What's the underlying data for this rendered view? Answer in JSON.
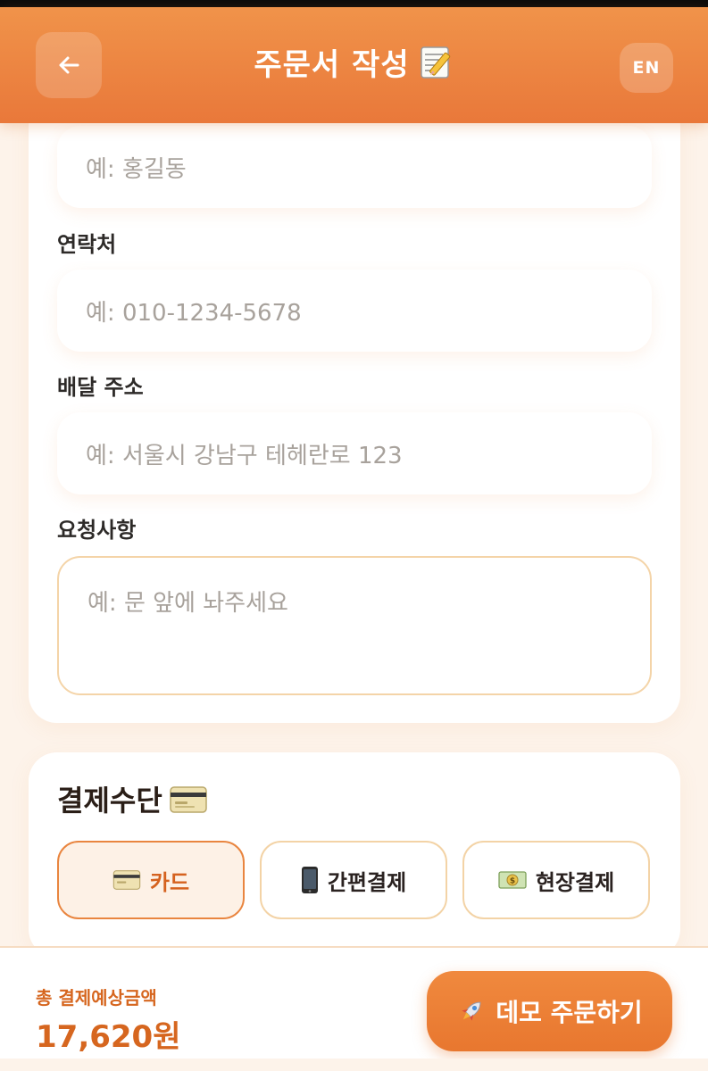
{
  "header": {
    "title": "주문서 작성",
    "title_icon": "memo-icon",
    "back_icon": "arrow-left-icon",
    "lang_label": "EN"
  },
  "form": {
    "name": {
      "placeholder": "예: 홍길동"
    },
    "phone": {
      "label": "연락처",
      "placeholder": "예: 010-1234-5678"
    },
    "address": {
      "label": "배달 주소",
      "placeholder": "예: 서울시 강남구 테헤란로 123"
    },
    "request": {
      "label": "요청사항",
      "placeholder": "예: 문 앞에 놔주세요"
    }
  },
  "payment": {
    "title": "결제수단",
    "title_icon": "credit-card-icon",
    "options": [
      {
        "label": "카드",
        "icon": "credit-card-icon",
        "selected": true
      },
      {
        "label": "간편결제",
        "icon": "mobile-phone-icon",
        "selected": false
      },
      {
        "label": "현장결제",
        "icon": "money-icon",
        "selected": false
      }
    ]
  },
  "footer": {
    "total_label": "총 결제예상금액",
    "total_amount": "17,620원",
    "order_button": "데모 주문하기",
    "order_icon": "rocket-icon"
  },
  "colors": {
    "accent": "#e9783a",
    "accent_text": "#d6661f",
    "border": "#f3d3a6"
  }
}
